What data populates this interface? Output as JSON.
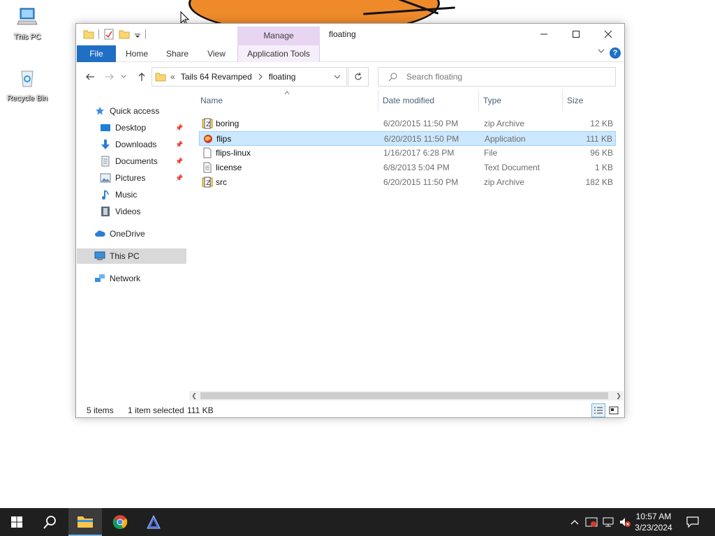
{
  "desktop": {
    "icons": [
      {
        "label": "This PC"
      },
      {
        "label": "Recycle Bin"
      }
    ]
  },
  "window": {
    "title": "floating",
    "context_tab_group": "Manage",
    "ribbon_tabs": [
      "File",
      "Home",
      "Share",
      "View",
      "Application Tools"
    ],
    "help_label": "?"
  },
  "navigation": {
    "breadcrumb_prefix": "«",
    "breadcrumb": [
      "Tails 64 Revamped",
      "floating"
    ],
    "search_placeholder": "Search floating"
  },
  "sidebar": {
    "items": [
      {
        "label": "Quick access",
        "icon": "star-icon"
      },
      {
        "label": "Desktop",
        "icon": "desktop-folder-icon",
        "pinned": true
      },
      {
        "label": "Downloads",
        "icon": "download-arrow-icon",
        "pinned": true
      },
      {
        "label": "Documents",
        "icon": "documents-icon",
        "pinned": true
      },
      {
        "label": "Pictures",
        "icon": "pictures-icon",
        "pinned": true
      },
      {
        "label": "Music",
        "icon": "music-note-icon"
      },
      {
        "label": "Videos",
        "icon": "film-icon"
      },
      {
        "label": "OneDrive",
        "icon": "cloud-icon"
      },
      {
        "label": "This PC",
        "icon": "computer-icon",
        "selected": true
      },
      {
        "label": "Network",
        "icon": "network-icon"
      }
    ]
  },
  "file_list": {
    "columns": [
      "Name",
      "Date modified",
      "Type",
      "Size"
    ],
    "rows": [
      {
        "name": "boring",
        "date": "6/20/2015 11:50 PM",
        "type": "zip Archive",
        "size": "12 KB",
        "icon": "zip-icon"
      },
      {
        "name": "flips",
        "date": "6/20/2015 11:50 PM",
        "type": "Application",
        "size": "111 KB",
        "icon": "app-icon",
        "selected": true
      },
      {
        "name": "flips-linux",
        "date": "1/16/2017 6:28 PM",
        "type": "File",
        "size": "96 KB",
        "icon": "blank-file-icon"
      },
      {
        "name": "license",
        "date": "6/8/2013 5:04 PM",
        "type": "Text Document",
        "size": "1 KB",
        "icon": "text-file-icon"
      },
      {
        "name": "src",
        "date": "6/20/2015 11:50 PM",
        "type": "zip Archive",
        "size": "182 KB",
        "icon": "zip-icon"
      }
    ]
  },
  "status": {
    "item_count": "5 items",
    "selection": "1 item selected",
    "selection_size": "111 KB"
  },
  "taskbar": {
    "time": "10:57 AM",
    "date": "3/23/2024"
  },
  "colors": {
    "accent": "#1f6fc5",
    "selection_bg": "#cce8ff",
    "manage_tab": "#e7d5f2",
    "taskbar": "#1f1f1f"
  }
}
